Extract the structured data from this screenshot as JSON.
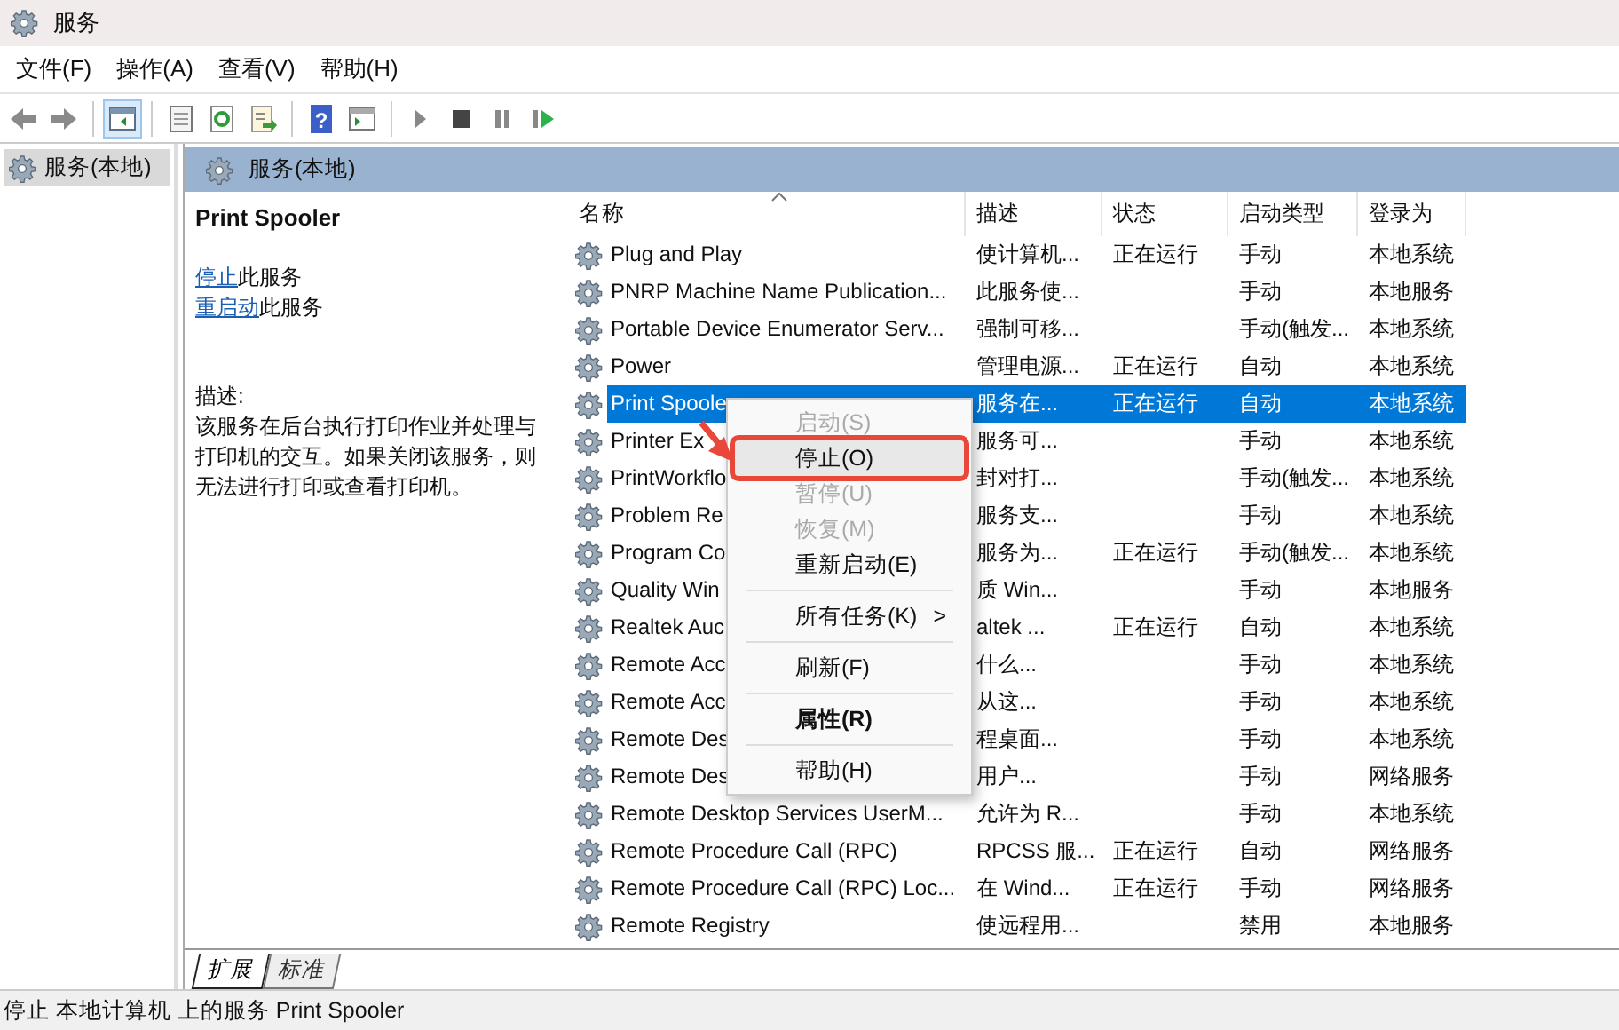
{
  "window": {
    "title": "服务"
  },
  "menu_bar": [
    "文件(F)",
    "操作(A)",
    "查看(V)",
    "帮助(H)"
  ],
  "toolbar": [
    {
      "kind": "back"
    },
    {
      "kind": "forward"
    },
    {
      "kind": "sep"
    },
    {
      "kind": "tree",
      "selected": true
    },
    {
      "kind": "sep"
    },
    {
      "kind": "sheet"
    },
    {
      "kind": "refresh"
    },
    {
      "kind": "export"
    },
    {
      "kind": "sep"
    },
    {
      "kind": "help",
      "glyph": "?"
    },
    {
      "kind": "view"
    },
    {
      "kind": "sep"
    },
    {
      "kind": "play"
    },
    {
      "kind": "stop"
    },
    {
      "kind": "pause"
    },
    {
      "kind": "resume"
    }
  ],
  "tree": [
    {
      "label": "服务(本地)",
      "selected": true
    }
  ],
  "pane_header": "服务(本地)",
  "details": {
    "title": "Print Spooler",
    "actions": [
      {
        "link": "停止",
        "text": "此服务"
      },
      {
        "link": "重启动",
        "text": "此服务"
      }
    ],
    "description_label": "描述:",
    "description": "该服务在后台执行打印作业并处理与打印机的交互。如果关闭该服务，则无法进行打印或查看打印机。"
  },
  "table": {
    "columns": [
      "名称",
      "描述",
      "状态",
      "启动类型",
      "登录为"
    ],
    "rows": [
      {
        "name": "Plug and Play",
        "desc": "使计算机...",
        "status": "正在运行",
        "startup": "手动",
        "logon": "本地系统",
        "selected": false
      },
      {
        "name": "PNRP Machine Name Publication...",
        "desc": "此服务使...",
        "status": "",
        "startup": "手动",
        "logon": "本地服务",
        "selected": false
      },
      {
        "name": "Portable Device Enumerator Serv...",
        "desc": "强制可移...",
        "status": "",
        "startup": "手动(触发...",
        "logon": "本地系统",
        "selected": false
      },
      {
        "name": "Power",
        "desc": "管理电源...",
        "status": "正在运行",
        "startup": "自动",
        "logon": "本地系统",
        "selected": false
      },
      {
        "name": "Print Spoole",
        "desc": "服务在...",
        "status": "正在运行",
        "startup": "自动",
        "logon": "本地系统",
        "selected": true
      },
      {
        "name": "Printer Ex",
        "desc": "服务可...",
        "status": "",
        "startup": "手动",
        "logon": "本地系统",
        "selected": false
      },
      {
        "name": "PrintWorkflo",
        "desc": "封对打...",
        "status": "",
        "startup": "手动(触发...",
        "logon": "本地系统",
        "selected": false
      },
      {
        "name": "Problem Re",
        "desc": "服务支...",
        "status": "",
        "startup": "手动",
        "logon": "本地系统",
        "selected": false
      },
      {
        "name": "Program Co",
        "desc": "服务为...",
        "status": "正在运行",
        "startup": "手动(触发...",
        "logon": "本地系统",
        "selected": false
      },
      {
        "name": "Quality Win",
        "desc": "质 Win...",
        "status": "",
        "startup": "手动",
        "logon": "本地服务",
        "selected": false
      },
      {
        "name": "Realtek Auc",
        "desc": "altek ...",
        "status": "正在运行",
        "startup": "自动",
        "logon": "本地系统",
        "selected": false
      },
      {
        "name": "Remote Acc",
        "desc": "什么...",
        "status": "",
        "startup": "手动",
        "logon": "本地系统",
        "selected": false
      },
      {
        "name": "Remote Acc",
        "desc": "从这...",
        "status": "",
        "startup": "手动",
        "logon": "本地系统",
        "selected": false
      },
      {
        "name": "Remote Des",
        "desc": "程桌面...",
        "status": "",
        "startup": "手动",
        "logon": "本地系统",
        "selected": false
      },
      {
        "name": "Remote Des",
        "desc": "用户...",
        "status": "",
        "startup": "手动",
        "logon": "网络服务",
        "selected": false
      },
      {
        "name": "Remote Desktop Services UserM...",
        "desc": "允许为 R...",
        "status": "",
        "startup": "手动",
        "logon": "本地系统",
        "selected": false
      },
      {
        "name": "Remote Procedure Call (RPC)",
        "desc": "RPCSS 服...",
        "status": "正在运行",
        "startup": "自动",
        "logon": "网络服务",
        "selected": false
      },
      {
        "name": "Remote Procedure Call (RPC) Loc...",
        "desc": "在 Wind...",
        "status": "正在运行",
        "startup": "手动",
        "logon": "网络服务",
        "selected": false
      },
      {
        "name": "Remote Registry",
        "desc": "使远程用...",
        "status": "",
        "startup": "禁用",
        "logon": "本地服务",
        "selected": false
      }
    ]
  },
  "view_tabs": [
    {
      "label": "扩展",
      "selected": true
    },
    {
      "label": "标准",
      "selected": false
    }
  ],
  "context_menu": [
    {
      "kind": "item",
      "label": "启动(S)",
      "disabled": true,
      "selected": false
    },
    {
      "kind": "item",
      "label": "停止(O)",
      "disabled": false,
      "selected": true
    },
    {
      "kind": "item",
      "label": "暂停(U)",
      "disabled": true,
      "selected": false
    },
    {
      "kind": "item",
      "label": "恢复(M)",
      "disabled": true,
      "selected": false
    },
    {
      "kind": "item",
      "label": "重新启动(E)",
      "disabled": false,
      "selected": false
    },
    {
      "kind": "sep"
    },
    {
      "kind": "submenu",
      "label": "所有任务(K)",
      "arrow": ">",
      "disabled": false,
      "selected": false
    },
    {
      "kind": "sep"
    },
    {
      "kind": "item",
      "label": "刷新(F)",
      "disabled": false,
      "selected": false
    },
    {
      "kind": "sep"
    },
    {
      "kind": "bold",
      "label": "属性(R)",
      "disabled": false,
      "selected": false
    },
    {
      "kind": "sep"
    },
    {
      "kind": "item",
      "label": "帮助(H)",
      "disabled": false,
      "selected": false
    }
  ],
  "status_bar": "停止 本地计算机 上的服务 Print Spooler"
}
